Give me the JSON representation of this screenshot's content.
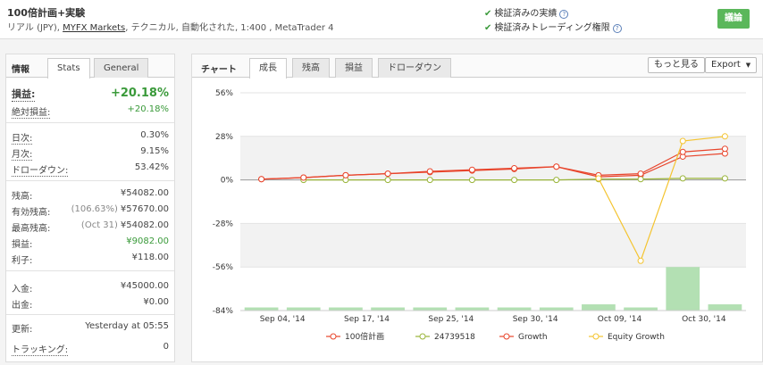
{
  "header": {
    "title": "100倍計画+実験",
    "subtitle_prefix": "リアル (JPY),",
    "broker_link": "MYFX Markets",
    "subtitle_suffix": ", テクニカル, 自動化された, 1:400 , MetaTrader 4",
    "verify_1": "検証済みの実績",
    "verify_2": "検証済みトレーディング権限",
    "discuss_button": "議論"
  },
  "left_panel": {
    "tab_info": "情報",
    "tab_stats": "Stats",
    "tab_general": "General",
    "gain_label": "損益:",
    "gain_value": "+20.18%",
    "abs_gain_label": "絶対損益:",
    "abs_gain_value": "+20.18%",
    "daily_label": "日次:",
    "daily_value": "0.30%",
    "monthly_label": "月次:",
    "monthly_value": "9.15%",
    "drawdown_label": "ドローダウン:",
    "drawdown_value": "53.42%",
    "balance_label": "残高:",
    "balance_value": "¥54082.00",
    "equity_label": "有効残高:",
    "equity_note": "(106.63%)",
    "equity_value": "¥57670.00",
    "highest_label": "最高残高:",
    "highest_note": "(Oct 31)",
    "highest_value": "¥54082.00",
    "profit_label": "損益:",
    "profit_value": "¥9082.00",
    "interest_label": "利子:",
    "interest_value": "¥118.00",
    "deposits_label": "入金:",
    "deposits_value": "¥45000.00",
    "withdrawals_label": "出金:",
    "withdrawals_value": "¥0.00",
    "updated_label": "更新:",
    "updated_value": "Yesterday at 05:55",
    "tracking_label": "トラッキング:",
    "tracking_value": "0"
  },
  "right_panel": {
    "chart_label": "チャート",
    "tabs": [
      "成長",
      "残高",
      "損益",
      "ドローダウン"
    ],
    "more_button": "もっと見る",
    "export_button": "Export"
  },
  "colors": {
    "growth": "#e8452c",
    "account": "#9ab53a",
    "equity": "#f4c430",
    "bars": "#b3e0b3"
  },
  "chart_data": {
    "type": "line",
    "x": [
      "Sep 04, '14",
      "",
      "Sep 17, '14",
      "",
      "Sep 25, '14",
      "",
      "Sep 30, '14",
      "",
      "Oct 09, '14",
      "",
      "Oct 30, '14",
      ""
    ],
    "yticks": [
      "56%",
      "28%",
      "0%",
      "-28%",
      "-56%",
      "-84%"
    ],
    "ylim": [
      -84,
      56
    ],
    "series": [
      {
        "name": "100倍計画",
        "values": [
          0.5,
          1.5,
          3,
          4,
          5,
          6,
          7,
          8.5,
          2,
          3,
          15,
          17
        ]
      },
      {
        "name": "24739518",
        "values": [
          null,
          0,
          0,
          0,
          0,
          0,
          0,
          0,
          0.5,
          0.5,
          1,
          1
        ]
      },
      {
        "name": "Growth",
        "values": [
          0.5,
          1.5,
          3,
          4,
          5.5,
          6.5,
          7.5,
          8.5,
          3,
          4,
          18,
          20
        ]
      },
      {
        "name": "Equity Growth",
        "values": [
          null,
          null,
          null,
          null,
          null,
          null,
          null,
          null,
          1,
          -52,
          25,
          28
        ]
      }
    ],
    "bars": [
      -82,
      -82,
      -82,
      -82,
      -82,
      -82,
      -82,
      -82,
      -80,
      -82,
      -56,
      -80
    ]
  }
}
